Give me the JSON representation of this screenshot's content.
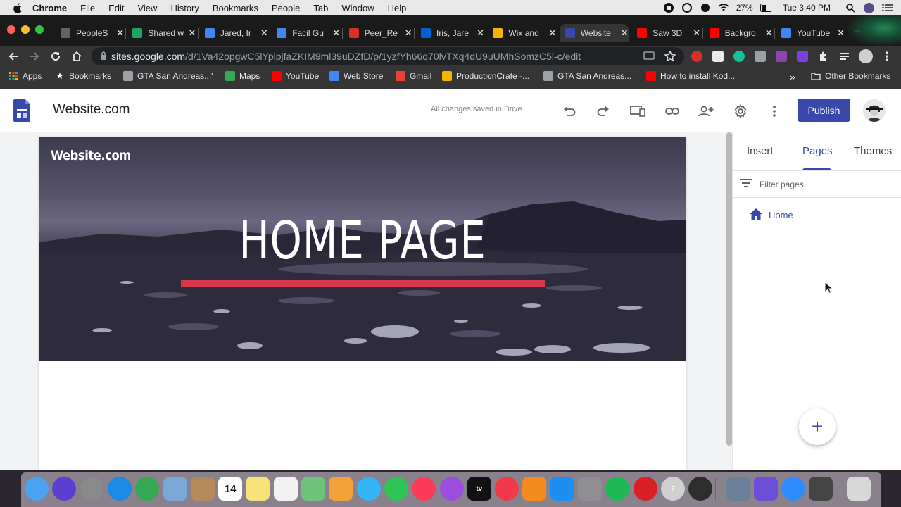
{
  "menubar": {
    "app": "Chrome",
    "items": [
      "File",
      "Edit",
      "View",
      "History",
      "Bookmarks",
      "People",
      "Tab",
      "Window",
      "Help"
    ],
    "battery": "27%",
    "clock": "Tue 3:40 PM"
  },
  "tabs": [
    {
      "label": "PeopleS",
      "icon": "globe-icon",
      "color": "#5f6368"
    },
    {
      "label": "Shared w",
      "icon": "drive-icon",
      "color": "#1fa463"
    },
    {
      "label": "Jared, Ir",
      "icon": "docs-icon",
      "color": "#4285f4"
    },
    {
      "label": "Facil Gu",
      "icon": "docs-icon",
      "color": "#4285f4"
    },
    {
      "label": "Peer_Re",
      "icon": "pdf-icon",
      "color": "#d93025"
    },
    {
      "label": "Iris, Jare",
      "icon": "box-icon",
      "color": "#0061d5"
    },
    {
      "label": "Wix and",
      "icon": "slides-icon",
      "color": "#f4b400"
    },
    {
      "label": "Website",
      "icon": "sites-icon",
      "color": "#3949ab",
      "active": true
    },
    {
      "label": "Saw 3D",
      "icon": "youtube-icon",
      "color": "#ff0000"
    },
    {
      "label": "Backgro",
      "icon": "youtube-icon",
      "color": "#ff0000"
    },
    {
      "label": "YouTube",
      "icon": "cloud-upload-icon",
      "color": "#4285f4"
    }
  ],
  "omnibox": {
    "host": "sites.google.com",
    "path": "/d/1Va42opgwC5lYplpjfaZKIM9ml39uDZfD/p/1yzfYh66q70lvTXq4dU9uUMhSomzC5l-c/edit"
  },
  "bookmarks": [
    {
      "label": "Apps",
      "icon": "apps-grid-icon"
    },
    {
      "label": "Bookmarks",
      "icon": "star-icon"
    },
    {
      "label": "GTA San Andreas...'",
      "icon": "page-icon"
    },
    {
      "label": "Maps",
      "icon": "maps-pin-icon"
    },
    {
      "label": "YouTube",
      "icon": "youtube-icon"
    },
    {
      "label": "Web Store",
      "icon": "webstore-icon"
    },
    {
      "label": "Gmail",
      "icon": "gmail-icon"
    },
    {
      "label": "ProductionCrate -...",
      "icon": "crate-icon"
    },
    {
      "label": "GTA San Andreas...",
      "icon": "page-icon"
    },
    {
      "label": "How to install Kod...",
      "icon": "youtube-icon"
    }
  ],
  "bookmarks_overflow": "»",
  "other_bookmarks": "Other Bookmarks",
  "sites": {
    "site_name": "Website.com",
    "save_status": "All changes saved in Drive",
    "publish": "Publish",
    "hero_brand": "Website.com",
    "hero_title": "HOME PAGE",
    "accent": "#3949ab",
    "hero_bar_color": "#d6374b"
  },
  "panel": {
    "tabs": [
      "Insert",
      "Pages",
      "Themes"
    ],
    "active_tab": "Pages",
    "filter_placeholder": "Filter pages",
    "pages": [
      "Home"
    ],
    "add_symbol": "+"
  },
  "dock": [
    {
      "name": "finder-icon",
      "color": "#4aa3f0"
    },
    {
      "name": "siri-icon",
      "color": "#5b3fd0"
    },
    {
      "name": "launchpad-icon",
      "color": "#8a8a8a"
    },
    {
      "name": "safari-icon",
      "color": "#1e88e5"
    },
    {
      "name": "chrome-icon",
      "color": "#34a853"
    },
    {
      "name": "preview-icon",
      "color": "#7aa6d8"
    },
    {
      "name": "contacts-icon",
      "color": "#b58a5a"
    },
    {
      "name": "calendar-icon",
      "color": "#ffffff",
      "text": "14"
    },
    {
      "name": "notes-icon",
      "color": "#f7e27a"
    },
    {
      "name": "reminders-icon",
      "color": "#f2f2f2"
    },
    {
      "name": "maps-icon",
      "color": "#6fc27a"
    },
    {
      "name": "photos-icon",
      "color": "#f2a23a"
    },
    {
      "name": "messages-icon",
      "color": "#33b5f5"
    },
    {
      "name": "facetime-icon",
      "color": "#2fc455"
    },
    {
      "name": "music-icon",
      "color": "#fa3c5a"
    },
    {
      "name": "podcasts-icon",
      "color": "#9b4de0"
    },
    {
      "name": "tv-icon",
      "color": "#111111",
      "text": "tv"
    },
    {
      "name": "news-icon",
      "color": "#f0394a"
    },
    {
      "name": "books-icon",
      "color": "#f28c1e"
    },
    {
      "name": "app-store-icon",
      "color": "#1e8ff2"
    },
    {
      "name": "system-preferences-icon",
      "color": "#8e8e93"
    },
    {
      "name": "spotify-icon",
      "color": "#1db954"
    },
    {
      "name": "creative-cloud-icon",
      "color": "#da1f26"
    },
    {
      "name": "help-icon",
      "color": "#cfcfcf",
      "text": "?"
    },
    {
      "name": "quicktime-icon",
      "color": "#2d2d2d"
    },
    {
      "name": "image-capture-icon",
      "color": "#6a7f98"
    },
    {
      "name": "imovie-icon",
      "color": "#6b4fd8"
    },
    {
      "name": "zoom-icon",
      "color": "#2d8cff"
    },
    {
      "name": "screenshot-icon",
      "color": "#444444"
    },
    {
      "name": "trash-icon",
      "color": "#d8d8d8"
    }
  ]
}
